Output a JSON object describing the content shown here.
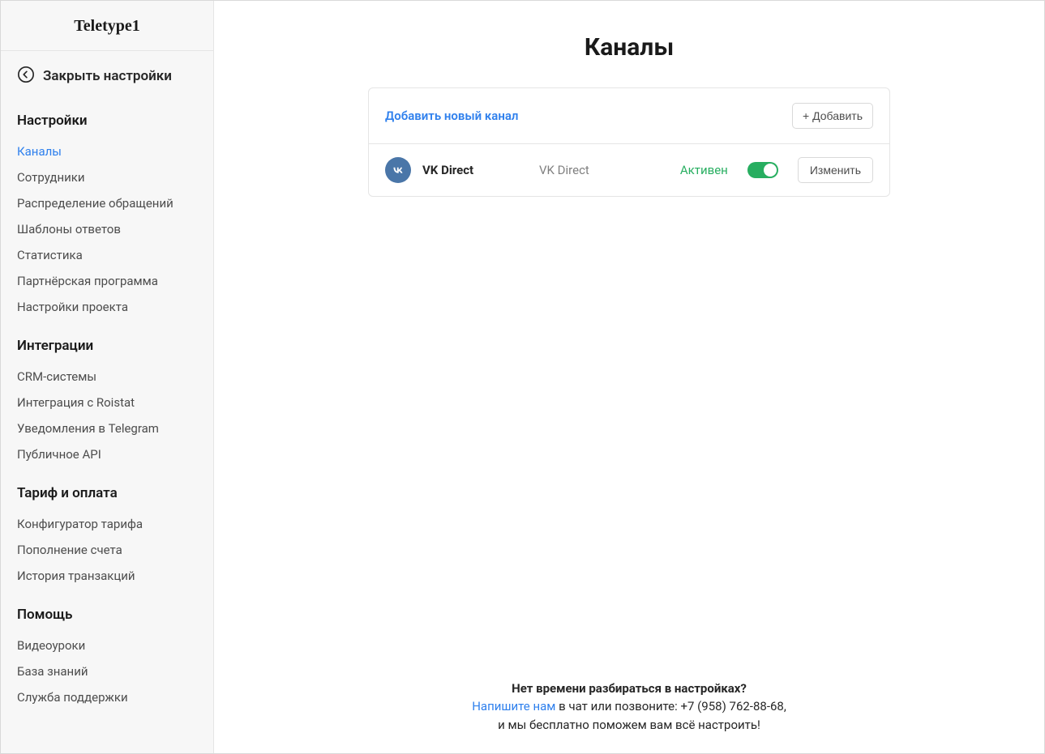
{
  "sidebar": {
    "app_name": "Teletype1",
    "close_label": "Закрыть настройки",
    "sections": [
      {
        "heading": "Настройки",
        "items": [
          {
            "label": "Каналы",
            "active": true
          },
          {
            "label": "Сотрудники",
            "active": false
          },
          {
            "label": "Распределение обращений",
            "active": false
          },
          {
            "label": "Шаблоны ответов",
            "active": false
          },
          {
            "label": "Статистика",
            "active": false
          },
          {
            "label": "Партнёрская программа",
            "active": false
          },
          {
            "label": "Настройки проекта",
            "active": false
          }
        ]
      },
      {
        "heading": "Интеграции",
        "items": [
          {
            "label": "CRM-системы",
            "active": false
          },
          {
            "label": "Интеграция с Roistat",
            "active": false
          },
          {
            "label": "Уведомления в Telegram",
            "active": false
          },
          {
            "label": "Публичное API",
            "active": false
          }
        ]
      },
      {
        "heading": "Тариф и оплата",
        "items": [
          {
            "label": "Конфигуратор тарифа",
            "active": false
          },
          {
            "label": "Пополнение счета",
            "active": false
          },
          {
            "label": "История транзакций",
            "active": false
          }
        ]
      },
      {
        "heading": "Помощь",
        "items": [
          {
            "label": "Видеоуроки",
            "active": false
          },
          {
            "label": "База знаний",
            "active": false
          },
          {
            "label": "Служба поддержки",
            "active": false
          }
        ]
      }
    ]
  },
  "main": {
    "title": "Каналы",
    "add_new_label": "Добавить новый канал",
    "add_button": "Добавить",
    "channels": [
      {
        "icon": "vk-icon",
        "icon_text": "w",
        "name": "VK Direct",
        "type": "VK Direct",
        "status": "Активен",
        "enabled": true,
        "edit_label": "Изменить"
      }
    ]
  },
  "footer": {
    "line1": "Нет времени разбираться в настройках?",
    "line2_link": "Напишите нам",
    "line2_rest": " в чат или позвоните: +7 (958) 762-88-68,",
    "line3": "и мы бесплатно поможем вам всё настроить!"
  }
}
